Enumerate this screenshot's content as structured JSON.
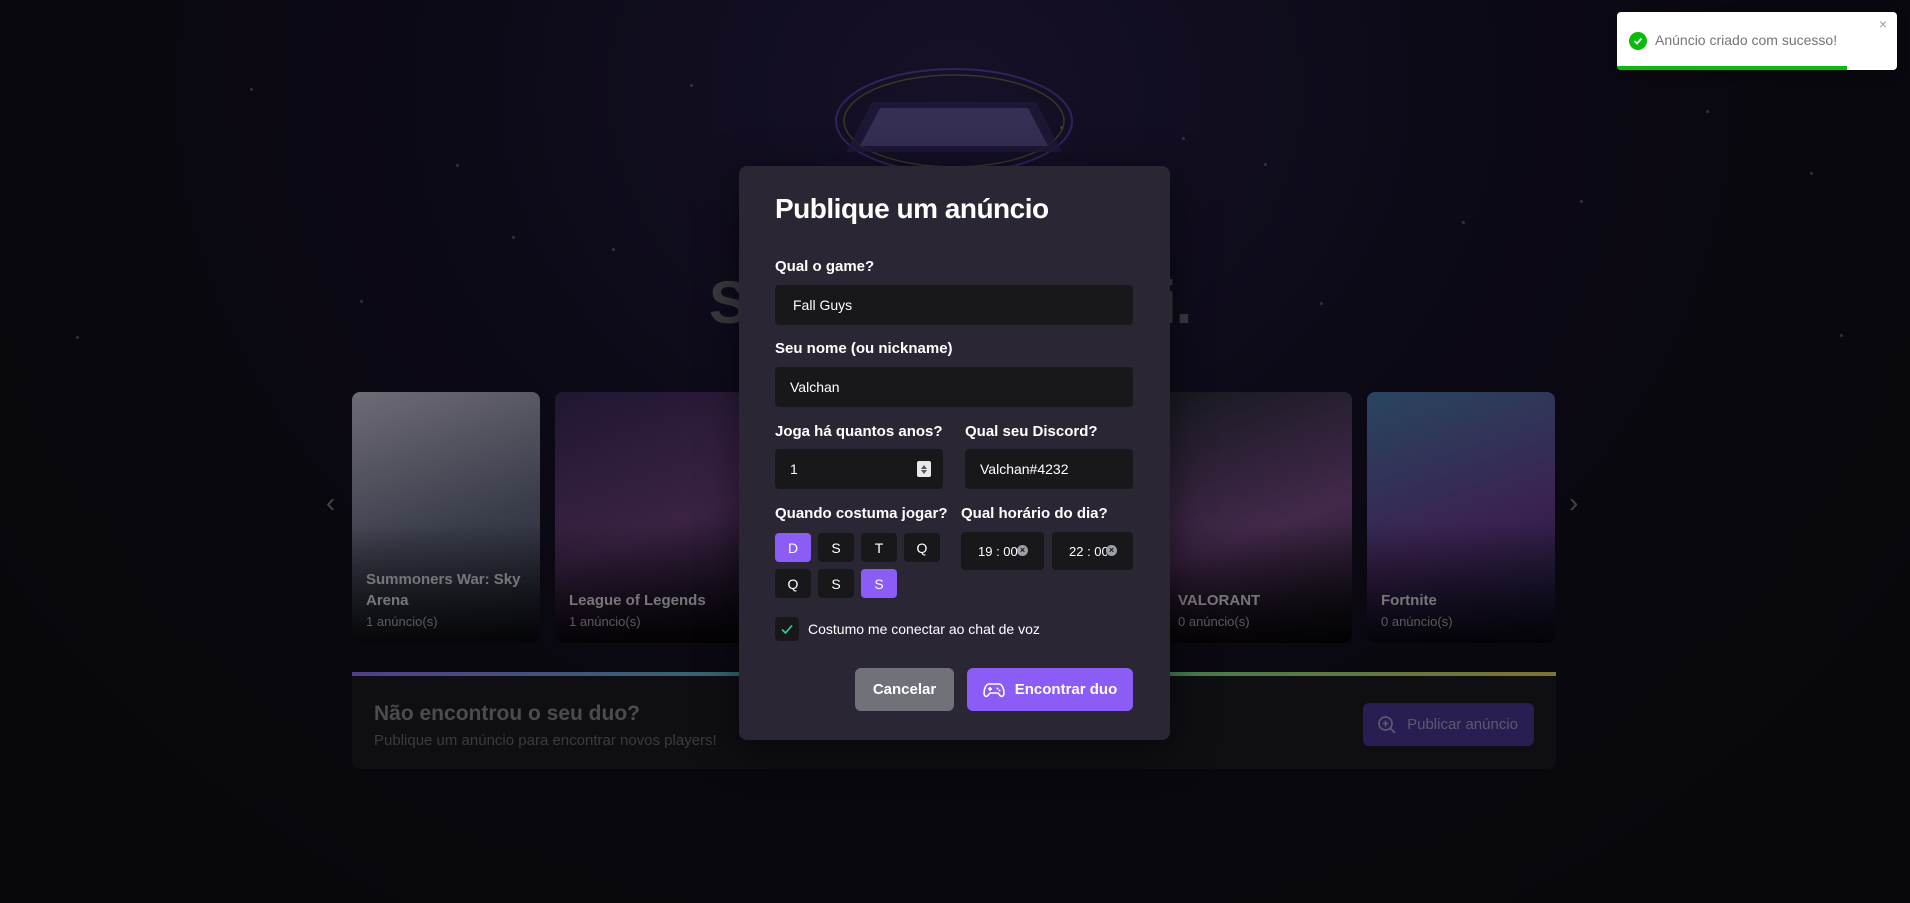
{
  "hero": {
    "left_text": "S",
    "right_text": "i."
  },
  "games": [
    {
      "title": "Summoners War: Sky Arena",
      "count": "1 anúncio(s)",
      "colors": [
        "#c8c4d6",
        "#6a6f88",
        "#3a3f57"
      ]
    },
    {
      "title": "League of Legends",
      "count": "1 anúncio(s)",
      "colors": [
        "#3b2a5a",
        "#6b3f7d",
        "#2a1f3a"
      ]
    },
    {
      "title": "VALORANT",
      "count": "0 anúncio(s)",
      "colors": [
        "#2b2f3c",
        "#7a4a8a",
        "#1f1e28"
      ]
    },
    {
      "title": "Fortnite",
      "count": "0 anúncio(s)",
      "colors": [
        "#4b7fae",
        "#6b3f94",
        "#2a2a5a"
      ]
    }
  ],
  "cta": {
    "title": "Não encontrou o seu duo?",
    "subtitle": "Publique um anúncio para encontrar novos players!",
    "button": "Publicar anúncio"
  },
  "modal": {
    "title": "Publique um anúncio",
    "game_label": "Qual o game?",
    "game_value": "Fall Guys",
    "name_label": "Seu nome (ou nickname)",
    "name_value": "Valchan",
    "years_label": "Joga há quantos anos?",
    "years_value": "1",
    "discord_label": "Qual seu Discord?",
    "discord_value": "Valchan#4232",
    "days_label": "Quando costuma jogar?",
    "days": [
      {
        "label": "D",
        "selected": true
      },
      {
        "label": "S",
        "selected": false
      },
      {
        "label": "T",
        "selected": false
      },
      {
        "label": "Q",
        "selected": false
      },
      {
        "label": "Q",
        "selected": false
      },
      {
        "label": "S",
        "selected": false
      },
      {
        "label": "S",
        "selected": true
      }
    ],
    "hours_label": "Qual horário do dia?",
    "hour_start": "19 : 00",
    "hour_end": "22 : 00",
    "voice_label": "Costumo me conectar ao chat de voz",
    "voice_checked": true,
    "cancel_label": "Cancelar",
    "submit_label": "Encontrar duo"
  },
  "toast": {
    "message": "Anúncio criado com sucesso!",
    "close": "×",
    "progress": 0.82
  },
  "colors": {
    "accent": "#8b5cf6",
    "success": "#07bc0c",
    "modal_bg": "#2a2634",
    "field_bg": "#18181b"
  }
}
